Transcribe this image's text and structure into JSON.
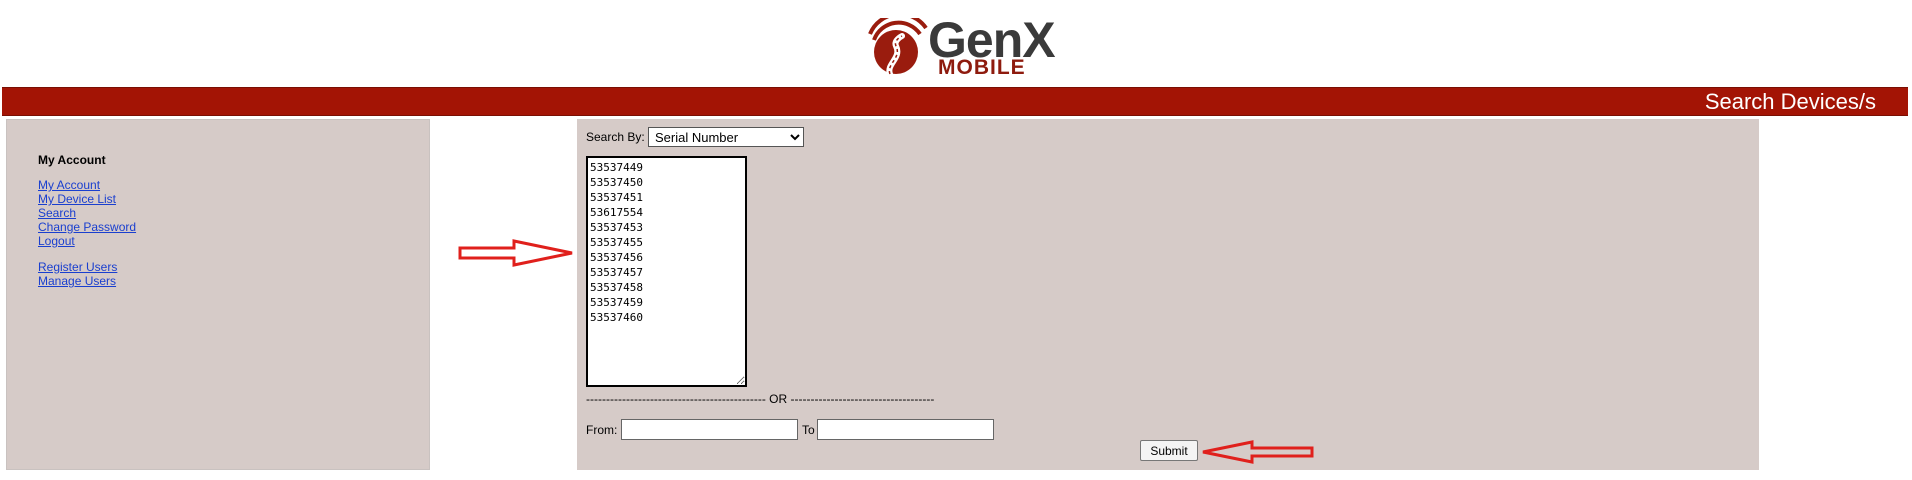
{
  "logo": {
    "name": "GenX",
    "subtitle": "MOBILE"
  },
  "header": {
    "title": "Search Devices/s"
  },
  "sidebar": {
    "heading": "My Account",
    "links_group1": [
      "My Account",
      "My Device List",
      "Search",
      "Change Password",
      "Logout"
    ],
    "links_group2": [
      "Register Users",
      "Manage Users"
    ]
  },
  "search": {
    "search_by_label": "Search By:",
    "search_by_selected": "Serial Number",
    "serials_value": "53537449\n53537450\n53537451\n53617554\n53537453\n53537455\n53537456\n53537457\n53537458\n53537459\n53537460\n",
    "or_divider": "--------------------------------------------- OR ------------------------------------",
    "from_label": "From:",
    "from_value": "",
    "to_label": "To",
    "to_value": "",
    "submit_label": "Submit"
  },
  "colors": {
    "header_bg": "#a31405",
    "panel_bg": "#d6cbc8",
    "link": "#1a3fcf",
    "arrow": "#e0201c"
  },
  "icons": {
    "logo_mark": "road-signal-logo-icon",
    "annotation": "red-arrow-icon"
  }
}
